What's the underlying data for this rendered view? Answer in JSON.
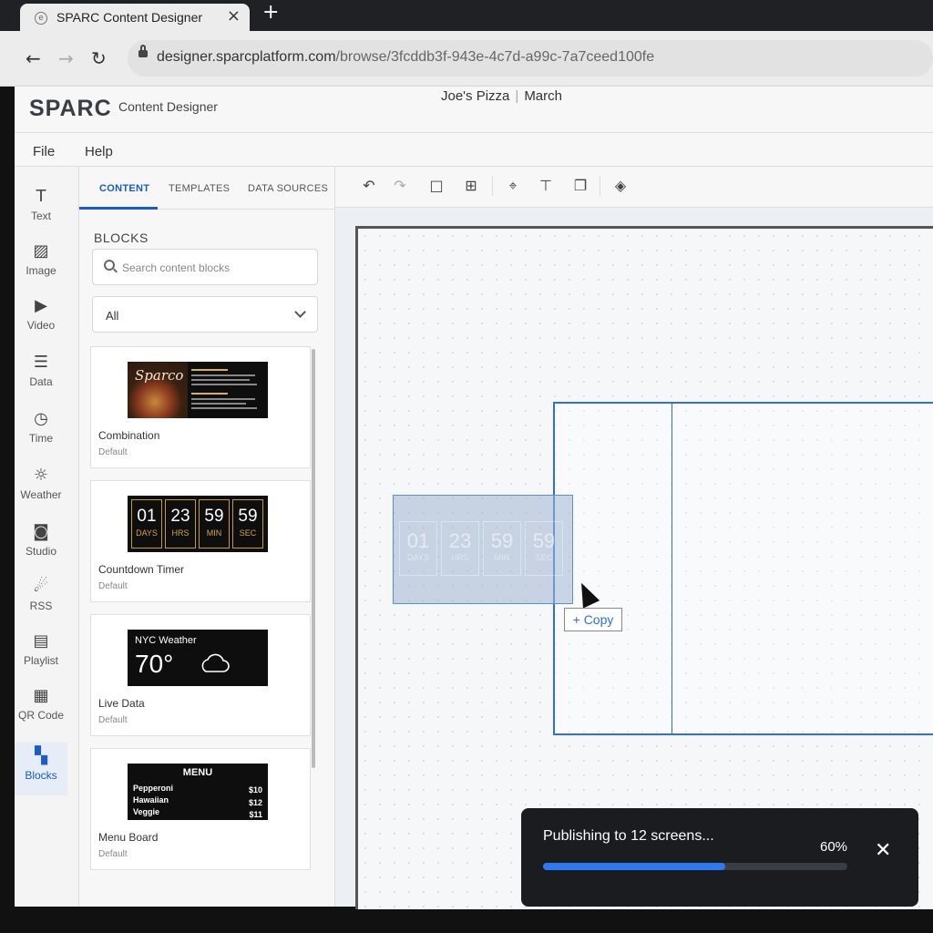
{
  "browser": {
    "tab_title": "SPARC Content Designer",
    "favicon": "e",
    "url_host": "designer.sparcplatform.com",
    "url_path": "/browse/3fcddb3f-943e-4c7d-a99c-7a7ceed100fe"
  },
  "app": {
    "logo": "SPARC",
    "name": "Content Designer",
    "doc_name": "Joe's Pizza",
    "doc_section": "March"
  },
  "menu": {
    "file": "File",
    "help": "Help"
  },
  "rail": [
    {
      "icon": "text-icon",
      "glyph": "T",
      "label": "Text"
    },
    {
      "icon": "image-icon",
      "glyph": "▨",
      "label": "Image"
    },
    {
      "icon": "video-icon",
      "glyph": "▶",
      "label": "Video"
    },
    {
      "icon": "data-icon",
      "glyph": "☰",
      "label": "Data"
    },
    {
      "icon": "time-icon",
      "glyph": "◷",
      "label": "Time"
    },
    {
      "icon": "weather-icon",
      "glyph": "☼",
      "label": "Weather"
    },
    {
      "icon": "studio-icon",
      "glyph": "◙",
      "label": "Studio"
    },
    {
      "icon": "rss-icon",
      "glyph": "☄",
      "label": "RSS"
    },
    {
      "icon": "playlist-icon",
      "glyph": "▤",
      "label": "Playlist"
    },
    {
      "icon": "qr-code-icon",
      "glyph": "▦",
      "label": "QR Code"
    },
    {
      "icon": "blocks-icon",
      "glyph": "▚",
      "label": "Blocks"
    }
  ],
  "panel": {
    "tabs": [
      "CONTENT",
      "TEMPLATES",
      "DATA SOURCES"
    ],
    "blocks_title": "BLOCKS",
    "search_placeholder": "Search content blocks",
    "filter_value": "All",
    "cards": [
      {
        "name": "Combination",
        "sub": "Default",
        "logo": "Sparco"
      },
      {
        "name": "Countdown Timer",
        "sub": "Default"
      },
      {
        "name": "Live Data",
        "sub": "Default"
      },
      {
        "name": "Menu Board",
        "sub": "Default"
      }
    ]
  },
  "countdown": [
    {
      "num": "01",
      "label": "DAYS"
    },
    {
      "num": "23",
      "label": "HRS"
    },
    {
      "num": "59",
      "label": "MIN"
    },
    {
      "num": "59",
      "label": "SEC"
    }
  ],
  "weather": {
    "city": "NYC Weather",
    "temp": "70°"
  },
  "menu_board": {
    "title": "MENU",
    "items": [
      {
        "name": "Pepperoni",
        "price": "$10"
      },
      {
        "name": "Hawaiian",
        "price": "$12"
      },
      {
        "name": "Veggie",
        "price": "$11"
      }
    ]
  },
  "canvas": {
    "copy_label": "+ Copy"
  },
  "toast": {
    "message": "Publishing to 12 screens...",
    "percent_text": "60%",
    "progress": 0.6,
    "close_glyph": "✕"
  },
  "colors": {
    "accent": "#1a5bc4",
    "selection": "#2f6fd6",
    "toast_bg": "#1a1c20"
  }
}
